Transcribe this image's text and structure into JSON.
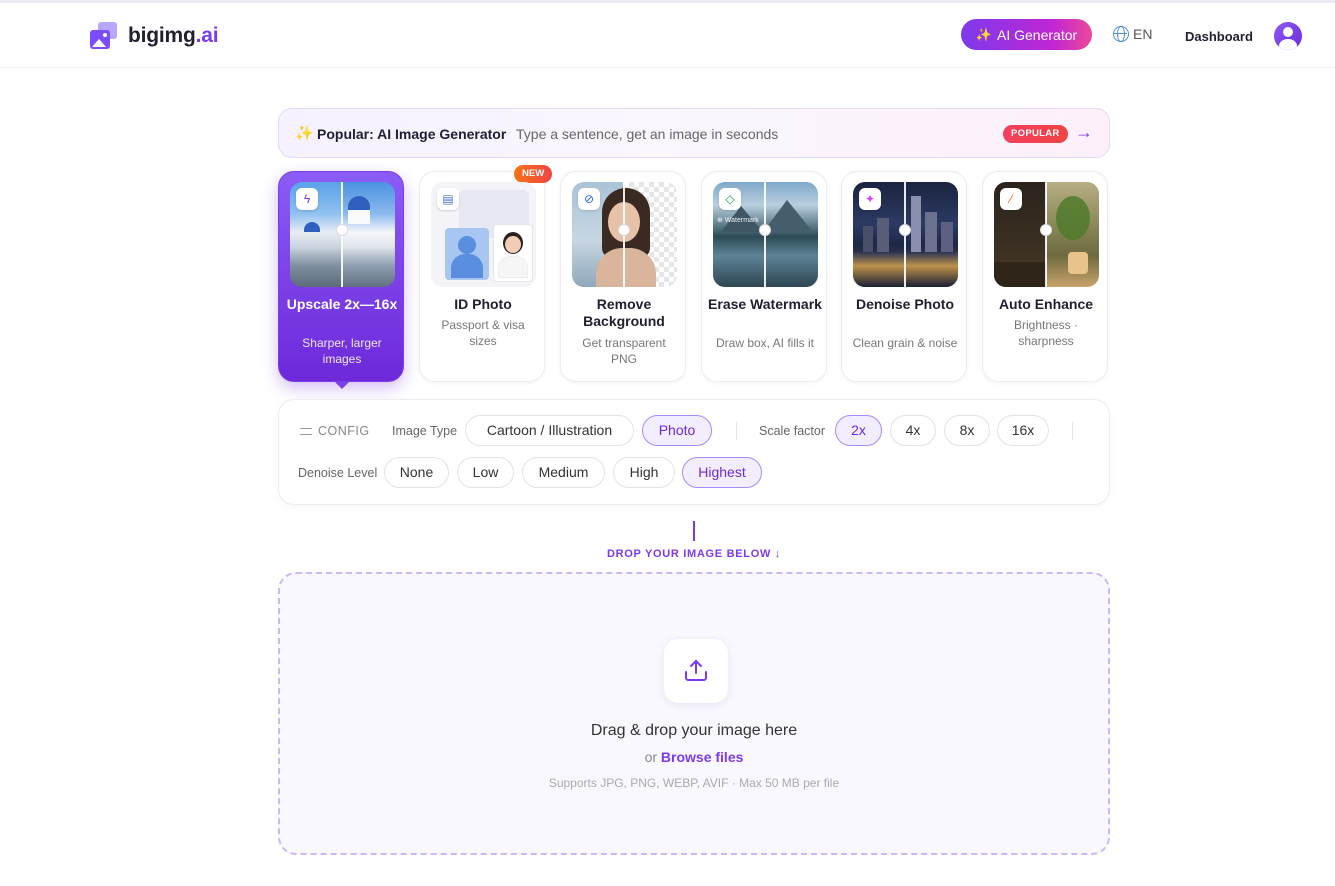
{
  "app": {
    "logo": {
      "name": "bigimg",
      "accent": ".ai"
    }
  },
  "header": {
    "ai_generator_label": "AI Generator",
    "ai_generator_icon": "sparkle-icon",
    "language": "EN",
    "language_icon": "globe-icon",
    "dashboard_label": "Dashboard"
  },
  "banner": {
    "title": "Popular: AI Image Generator",
    "subtitle": "Type a sentence, get an image in seconds",
    "badge": "POPULAR",
    "arrow": "→"
  },
  "tools": [
    {
      "title": "Upscale 2x—16x",
      "subtitle": "Sharper, larger images",
      "icon": "bolt-icon",
      "active": true
    },
    {
      "title": "ID Photo",
      "subtitle": "Passport & visa sizes",
      "badge": "NEW",
      "icon": "id-card-icon",
      "active": false
    },
    {
      "title": "Remove Background",
      "subtitle": "Get transparent PNG",
      "icon": "no-image-icon",
      "active": false
    },
    {
      "title": "Erase Watermark",
      "subtitle": "Draw box, AI fills it",
      "icon": "eraser-icon",
      "active": false
    },
    {
      "title": "Denoise Photo",
      "subtitle": "Clean grain & noise",
      "icon": "sparkles-icon",
      "active": false
    },
    {
      "title": "Auto Enhance",
      "subtitle": "Brightness · sharpness",
      "icon": "magic-wand-icon",
      "active": false
    }
  ],
  "config": {
    "heading": "CONFIG",
    "image_type": {
      "label": "Image Type",
      "options": [
        "Cartoon / Illustration",
        "Photo"
      ],
      "selected": "Photo"
    },
    "scale_factor": {
      "label": "Scale factor",
      "options": [
        "2x",
        "4x",
        "8x",
        "16x"
      ],
      "selected": "2x"
    },
    "denoise_level": {
      "label": "Denoise Level",
      "options": [
        "None",
        "Low",
        "Medium",
        "High",
        "Highest"
      ],
      "selected": "Highest"
    }
  },
  "drop_hint": "DROP YOUR IMAGE BELOW ↓",
  "dropzone": {
    "title": "Drag & drop your image here",
    "or_text": "or",
    "browse_label": "Browse files",
    "support_text": "Supports JPG, PNG, WEBP, AVIF · Max 50 MB per file"
  },
  "colors": {
    "accent": "#7c3aed",
    "accent_light": "#f3eeff",
    "badge_red": "#ef4444"
  }
}
